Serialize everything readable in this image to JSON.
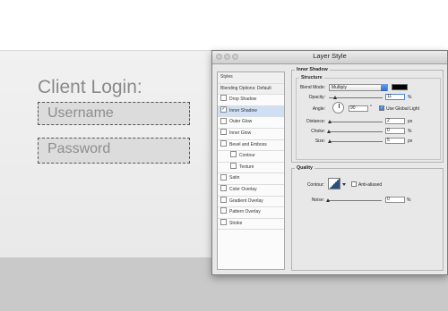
{
  "login": {
    "title": "Client Login:",
    "username_placeholder": "Username",
    "password_placeholder": "Password"
  },
  "dialog": {
    "title": "Layer Style",
    "sidebar": {
      "header": "Styles",
      "blending": "Blending Options: Default",
      "items": [
        {
          "label": "Drop Shadow",
          "checked": false,
          "selected": false,
          "indent": false
        },
        {
          "label": "Inner Shadow",
          "checked": true,
          "selected": true,
          "indent": false
        },
        {
          "label": "Outer Glow",
          "checked": false,
          "selected": false,
          "indent": false
        },
        {
          "label": "Inner Glow",
          "checked": false,
          "selected": false,
          "indent": false
        },
        {
          "label": "Bevel and Emboss",
          "checked": false,
          "selected": false,
          "indent": false
        },
        {
          "label": "Contour",
          "checked": false,
          "selected": false,
          "indent": true
        },
        {
          "label": "Texture",
          "checked": false,
          "selected": false,
          "indent": true
        },
        {
          "label": "Satin",
          "checked": false,
          "selected": false,
          "indent": false
        },
        {
          "label": "Color Overlay",
          "checked": false,
          "selected": false,
          "indent": false
        },
        {
          "label": "Gradient Overlay",
          "checked": false,
          "selected": false,
          "indent": false
        },
        {
          "label": "Pattern Overlay",
          "checked": false,
          "selected": false,
          "indent": false
        },
        {
          "label": "Stroke",
          "checked": false,
          "selected": false,
          "indent": false
        }
      ]
    },
    "inner_shadow": {
      "section_title": "Inner Shadow",
      "structure_title": "Structure",
      "blend_mode_label": "Blend Mode:",
      "blend_mode_value": "Multiply",
      "shadow_color": "#000000",
      "opacity_label": "Opacity:",
      "opacity_value": "11",
      "opacity_unit": "%",
      "angle_label": "Angle:",
      "angle_value": "90",
      "angle_unit": "°",
      "use_global_light_label": "Use Global Light",
      "use_global_light_checked": true,
      "distance_label": "Distance:",
      "distance_value": "2",
      "distance_unit": "px",
      "choke_label": "Choke:",
      "choke_value": "0",
      "choke_unit": "%",
      "size_label": "Size:",
      "size_value": "5",
      "size_unit": "px"
    },
    "quality": {
      "section_title": "Quality",
      "contour_label": "Contour:",
      "anti_aliased_label": "Anti-aliased",
      "anti_aliased_checked": false,
      "noise_label": "Noise:",
      "noise_value": "0",
      "noise_unit": "%"
    }
  }
}
